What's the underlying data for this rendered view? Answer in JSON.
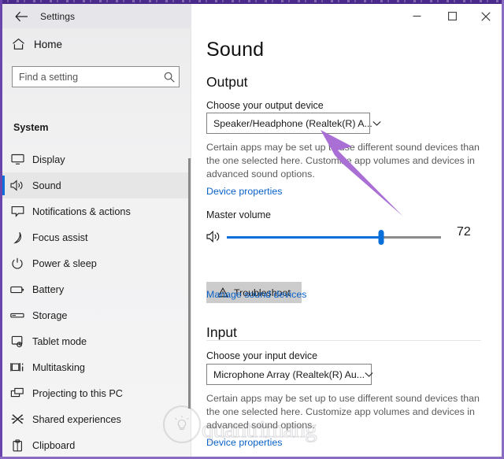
{
  "window": {
    "title": "Settings",
    "back_icon": "back-arrow-icon",
    "minimize_icon": "minimize-icon",
    "maximize_icon": "maximize-icon",
    "close_icon": "close-icon",
    "accent_color": "#0a6fd8",
    "desktop_edge_color": "#4b2a8c"
  },
  "sidebar": {
    "home_label": "Home",
    "home_icon": "home-icon",
    "search": {
      "placeholder": "Find a setting",
      "value": "",
      "icon": "search-icon"
    },
    "group_title": "System",
    "selected": "Sound",
    "items": [
      {
        "label": "Display",
        "icon": "monitor-icon"
      },
      {
        "label": "Sound",
        "icon": "speaker-icon"
      },
      {
        "label": "Notifications & actions",
        "icon": "notification-icon"
      },
      {
        "label": "Focus assist",
        "icon": "moon-icon"
      },
      {
        "label": "Power & sleep",
        "icon": "power-icon"
      },
      {
        "label": "Battery",
        "icon": "battery-icon"
      },
      {
        "label": "Storage",
        "icon": "storage-icon"
      },
      {
        "label": "Tablet mode",
        "icon": "tablet-icon"
      },
      {
        "label": "Multitasking",
        "icon": "multitasking-icon"
      },
      {
        "label": "Projecting to this PC",
        "icon": "projecting-icon"
      },
      {
        "label": "Shared experiences",
        "icon": "shared-experiences-icon"
      },
      {
        "label": "Clipboard",
        "icon": "clipboard-icon"
      }
    ]
  },
  "main": {
    "page_title": "Sound",
    "output": {
      "heading": "Output",
      "device_label": "Choose your output device",
      "device_value": "Speaker/Headphone (Realtek(R) A...",
      "dropdown_icon": "chevron-down-icon",
      "note": "Certain apps may be set up to use different sound devices than the one selected here. Customize app volumes and devices in advanced sound options.",
      "device_properties_link": "Device properties",
      "master_volume_label": "Master volume",
      "volume_icon": "speaker-icon",
      "volume_value": "72",
      "volume_percent": 72,
      "troubleshoot_label": "Troubleshoot",
      "troubleshoot_icon": "warning-triangle-icon",
      "manage_sound_devices_link": "Manage sound devices"
    },
    "input": {
      "heading": "Input",
      "device_label": "Choose your input device",
      "device_value": "Microphone Array (Realtek(R) Au...",
      "dropdown_icon": "chevron-down-icon",
      "note": "Certain apps may be set up to use different sound devices than the one selected here. Customize app volumes and devices in advanced sound options.",
      "device_properties_link": "Device properties"
    }
  },
  "annotation": {
    "arrow_color": "#a96fd4",
    "arrow_icon": "pointer-arrow-annotation"
  },
  "watermark": {
    "text": "quantrimang",
    "logo_icon": "lightbulb-icon"
  }
}
